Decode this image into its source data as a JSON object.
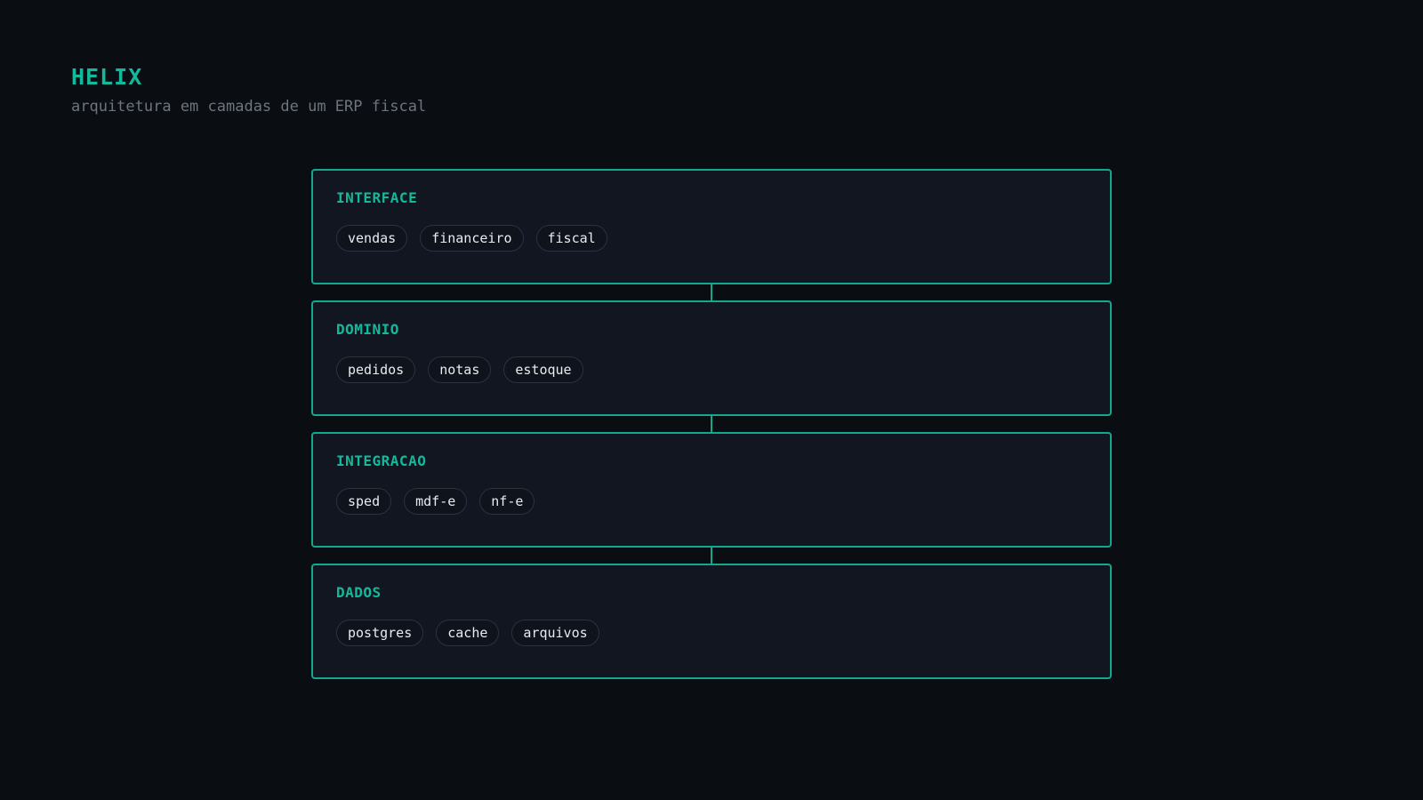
{
  "header": {
    "title": "HELIX",
    "subtitle": "arquitetura em camadas de um ERP fiscal"
  },
  "colors": {
    "accent": "#14b89a",
    "border": "#14a88d",
    "background": "#0a0d12",
    "panel": "#111621"
  },
  "layers": [
    {
      "name": "INTERFACE",
      "items": [
        "vendas",
        "financeiro",
        "fiscal"
      ]
    },
    {
      "name": "DOMINIO",
      "items": [
        "pedidos",
        "notas",
        "estoque"
      ]
    },
    {
      "name": "INTEGRACAO",
      "items": [
        "sped",
        "mdf-e",
        "nf-e"
      ]
    },
    {
      "name": "DADOS",
      "items": [
        "postgres",
        "cache",
        "arquivos"
      ]
    }
  ]
}
